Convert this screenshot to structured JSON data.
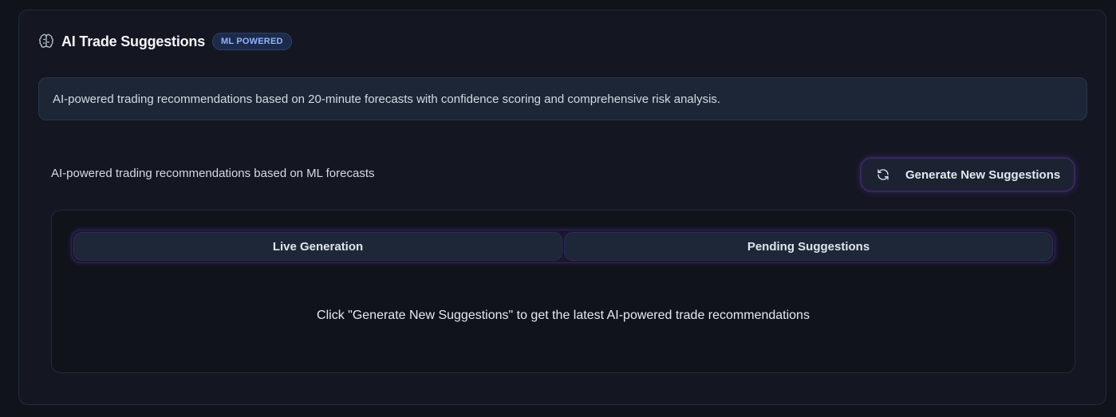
{
  "header": {
    "icon": "brain-icon",
    "title": "AI Trade Suggestions",
    "badge": "ML POWERED"
  },
  "info": {
    "text": "AI-powered trading recommendations based on 20-minute forecasts with confidence scoring and comprehensive risk analysis."
  },
  "toolbar": {
    "subtitle": "AI-powered trading recommendations based on ML forecasts",
    "generate_icon": "refresh-icon",
    "generate_label": "Generate New Suggestions"
  },
  "tabs": [
    {
      "label": "Live Generation"
    },
    {
      "label": "Pending Suggestions"
    }
  ],
  "empty_state": {
    "message": "Click \"Generate New Suggestions\" to get the latest AI-powered trade recommendations"
  },
  "colors": {
    "background": "#11131a",
    "card": "#141722",
    "badge_text": "#8fb4ff",
    "accent_glow": "#3a2660"
  }
}
